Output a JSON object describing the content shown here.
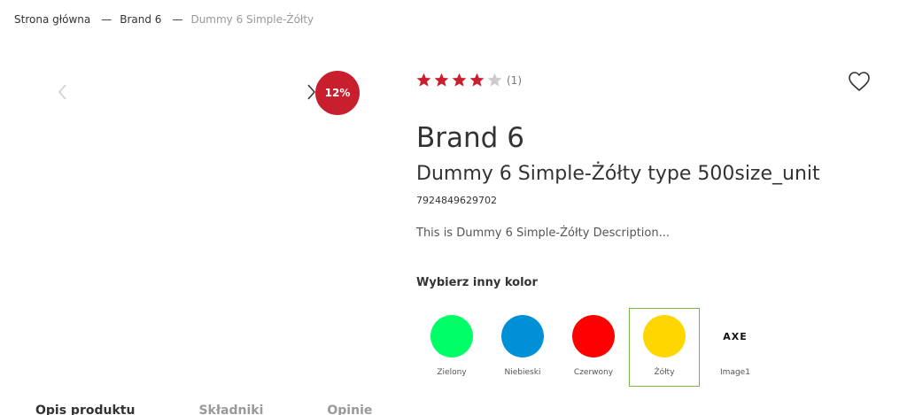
{
  "breadcrumb": {
    "home": "Strona główna",
    "brand": "Brand 6",
    "current": "Dummy 6 Simple-Żółty",
    "separator": "—"
  },
  "gallery": {
    "discount_badge": "12%",
    "prev_icon": "chevron-left-icon",
    "next_icon": "chevron-right-icon",
    "badge_color": "#c81e2d"
  },
  "rating": {
    "stars": 4,
    "max_stars": 5,
    "count": "(1)",
    "star_color": "#c81e2d"
  },
  "wishlist": {
    "icon": "heart-icon"
  },
  "product": {
    "brand": "Brand 6",
    "name": "Dummy 6 Simple-Żółty type 500size_unit",
    "ean": "7924849629702",
    "description": "This is Dummy 6 Simple-Żółty Description..."
  },
  "color_picker": {
    "heading": "Wybierz inny kolor",
    "options": [
      {
        "label": "Zielony",
        "color": "#00ff66"
      },
      {
        "label": "Niebieski",
        "color": "#0090d8"
      },
      {
        "label": "Czerwony",
        "color": "#ff0000"
      },
      {
        "label": "Żółty",
        "color": "#ffd600",
        "selected": true
      },
      {
        "label": "Image1",
        "logo": "AXE"
      }
    ]
  },
  "tabs": [
    {
      "label": "Opis produktu",
      "active": true
    },
    {
      "label": "Składniki"
    },
    {
      "label": "Opinie"
    }
  ]
}
